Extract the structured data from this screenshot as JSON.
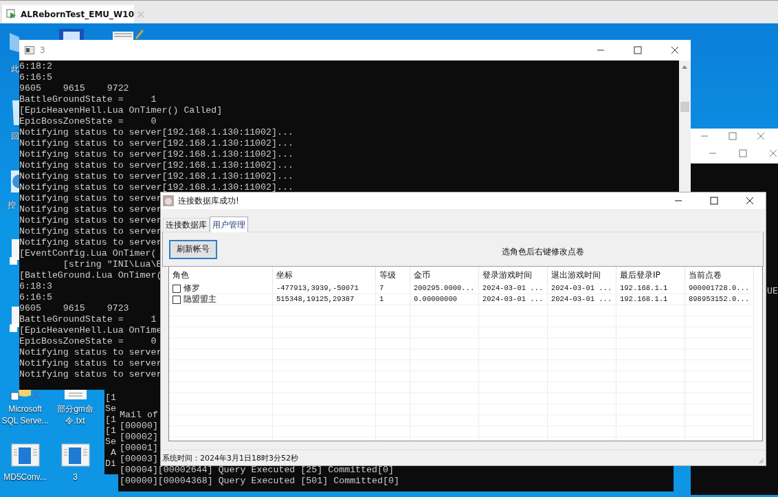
{
  "vm_tab": {
    "title": "ALRebornTest_EMU_W10"
  },
  "desktop": {
    "partial_labels": [
      "此",
      "回",
      "控"
    ],
    "icons": [
      {
        "label": "Microsoft SQL Serve...",
        "kind": "database"
      },
      {
        "label": "部分gm命令.txt",
        "kind": "text"
      },
      {
        "label": "MD5Conv...",
        "kind": "app"
      },
      {
        "label": "3",
        "kind": "app"
      }
    ]
  },
  "background_windows": [
    {
      "kind": "titlebar"
    },
    {
      "kind": "titled_console",
      "lines": [
        "UE"
      ]
    },
    {
      "kind": "console",
      "lines": [
        "[1",
        "Se",
        "[1",
        "[1",
        "Se",
        " A",
        "Di"
      ]
    },
    {
      "kind": "console",
      "lines": [
        "Mail of",
        "[00000]",
        "[00002]",
        "[00001]",
        "[00003]",
        "[00004][00002644] Query Executed [25] Committed[0]",
        "[00000][00004368] Query Executed [501] Committed[0]"
      ]
    }
  ],
  "console_window": {
    "title": "3",
    "lines": [
      "6:18:2",
      "6:16:5",
      "9605    9615    9722",
      "BattleGroundState =     1",
      "[EpicHeavenHell.Lua OnTimer() Called]",
      "EpicBossZoneState =     0",
      "Notifying status to server[192.168.1.130:11002]...",
      "Notifying status to server[192.168.1.130:11002]...",
      "Notifying status to server[192.168.1.130:11002]...",
      "Notifying status to server[192.168.1.130:11002]...",
      "Notifying status to server[192.168.1.130:11002]...",
      "Notifying status to server[192.168.1.130:11002]...",
      "Notifying status to server",
      "Notifying status to server",
      "Notifying status to server",
      "Notifying status to server",
      "Notifying status to server",
      "[EventConfig.Lua OnTimer(",
      "        [string \"INI\\Lua\\E",
      "[BattleGround.Lua OnTimer(",
      "6:18:3",
      "6:16:5",
      "9605    9615    9723",
      "BattleGroundState =     1",
      "[EpicHeavenHell.Lua OnTime",
      "EpicBossZoneState =     0",
      "Notifying status to server",
      "Notifying status to server",
      "Notifying status to server"
    ]
  },
  "dialog": {
    "title": "连接数据库成功!",
    "tabs": [
      {
        "label": "连接数据库",
        "selected": false
      },
      {
        "label": "用户管理",
        "selected": true
      }
    ],
    "refresh_button": "刷新帐号",
    "hint": "选角色后右键修改点卷",
    "table": {
      "columns": [
        "角色",
        "坐标",
        "等级",
        "金币",
        "登录游戏时间",
        "退出游戏时间",
        "最后登录IP",
        "当前点卷"
      ],
      "rows": [
        {
          "checked": false,
          "cells": [
            "修罗",
            "-477913,3939,-50071",
            "7",
            "200295.0000...",
            "2024-03-01 ...",
            "2024-03-01 ...",
            "192.168.1.1",
            "900001728.0..."
          ]
        },
        {
          "checked": false,
          "cells": [
            "隐盟盟主",
            "515348,19125,29387",
            "1",
            "0.00000000",
            "2024-03-01 ...",
            "2024-03-01 ...",
            "192.168.1.1",
            "898953152.0..."
          ]
        }
      ]
    },
    "status": "系统时间：2024年3月1日18时3分52秒"
  }
}
